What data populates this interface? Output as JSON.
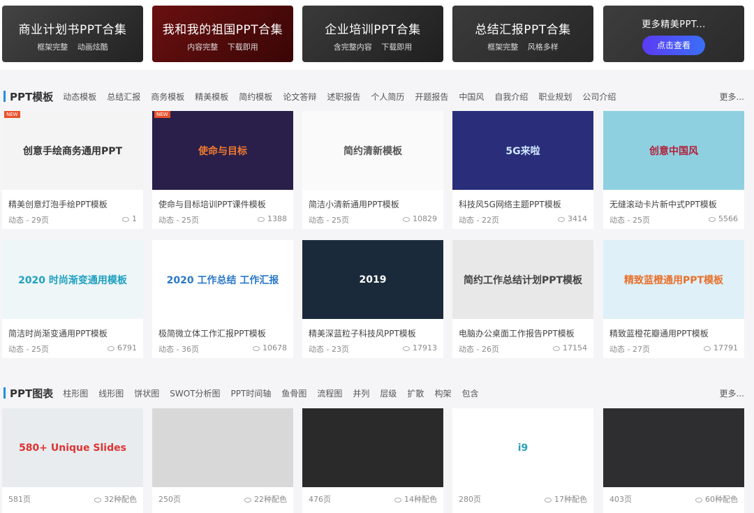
{
  "banners": [
    {
      "title": "商业计划书PPT合集",
      "sub": "框架完整 动画炫酷",
      "bg": "linear-gradient(135deg,#444,#222)"
    },
    {
      "title": "我和我的祖国PPT合集",
      "sub": "内容完整 下载即用",
      "bg": "linear-gradient(135deg,#6a1010,#3a0606)"
    },
    {
      "title": "企业培训PPT合集",
      "sub": "含完整内容 下载即用",
      "bg": "linear-gradient(135deg,#3a3a3a,#1f1f1f)"
    },
    {
      "title": "总结汇报PPT合集",
      "sub": "框架完整 风格多样",
      "bg": "linear-gradient(135deg,#3b3b3b,#262626)"
    },
    {
      "title": "更多精美PPT...",
      "button": "点击查看",
      "bg": "linear-gradient(135deg,#3d3d3d,#2a2a2a)"
    }
  ],
  "templates": {
    "title": "PPT模板",
    "categories": [
      "动态模板",
      "总结汇报",
      "商务模板",
      "精美模板",
      "简约模板",
      "论文答辩",
      "述职报告",
      "个人简历",
      "开题报告",
      "中国风",
      "自我介绍",
      "职业规划",
      "公司介绍"
    ],
    "more": "更多...",
    "new_badge": "NEW",
    "cards": [
      {
        "thumb": "创意手绘商务通用PPT",
        "bg": "#f4f4f4",
        "fg": "#333",
        "new": true,
        "name": "精美创意灯泡手绘PPT模板",
        "meta": "动态 - 29页",
        "views": "1"
      },
      {
        "thumb": "使命与目标",
        "bg": "#2a1f4a",
        "fg": "#f07a30",
        "new": true,
        "name": "使命与目标培训PPT课件模板",
        "meta": "动态 - 25页",
        "views": "1388"
      },
      {
        "thumb": "简约清新模板",
        "bg": "#fafafa",
        "fg": "#555",
        "name": "简洁小清新通用PPT模板",
        "meta": "动态 - 25页",
        "views": "10829"
      },
      {
        "thumb": "5G来啦",
        "bg": "#2a2d7a",
        "fg": "#cfe8ff",
        "name": "科技风5G网络主题PPT模板",
        "meta": "动态 - 22页",
        "views": "3414"
      },
      {
        "thumb": "创意中国风",
        "bg": "#8fd0e0",
        "fg": "#b0203a",
        "name": "无缝滚动卡片新中式PPT模板",
        "meta": "动态 - 25页",
        "views": "5566"
      },
      {
        "thumb": "2020 时尚渐变通用模板",
        "bg": "#eef6f8",
        "fg": "#1fa0c0",
        "name": "简洁时尚渐变通用PPT模板",
        "meta": "动态 - 25页",
        "views": "6791"
      },
      {
        "thumb": "2020 工作总结 工作汇报",
        "bg": "#ffffff",
        "fg": "#2a78c8",
        "name": "极简微立体工作汇报PPT模板",
        "meta": "动态 - 36页",
        "views": "10678"
      },
      {
        "thumb": "2019",
        "bg": "#1a2a3a",
        "fg": "#fff",
        "name": "精美深蓝粒子科技风PPT模板",
        "meta": "动态 - 23页",
        "views": "17913"
      },
      {
        "thumb": "简约工作总结计划PPT模板",
        "bg": "#e8e8e8",
        "fg": "#444",
        "name": "电脑办公桌面工作报告PPT模板",
        "meta": "动态 - 26页",
        "views": "17154"
      },
      {
        "thumb": "精致蓝橙通用PPT模板",
        "bg": "#dff0f8",
        "fg": "#e8712c",
        "name": "精致蓝橙花瓣通用PPT模板",
        "meta": "动态 - 27页",
        "views": "17791"
      }
    ]
  },
  "charts": {
    "title": "PPT图表",
    "categories": [
      "柱形图",
      "线形图",
      "饼状图",
      "SWOT分析图",
      "PPT时间轴",
      "鱼骨图",
      "流程图",
      "并列",
      "层级",
      "扩散",
      "构架",
      "包含"
    ],
    "more": "更多...",
    "cards": [
      {
        "thumb": "580+ Unique Slides",
        "bg": "#e8ecee",
        "fg": "#d33",
        "pages": "581页",
        "colors": "32种配色"
      },
      {
        "thumb": "",
        "bg": "#d8d8d8",
        "fg": "#333",
        "pages": "250页",
        "colors": "22种配色"
      },
      {
        "thumb": "",
        "bg": "#2a2a2a",
        "fg": "#fff",
        "pages": "476页",
        "colors": "14种配色"
      },
      {
        "thumb": "i9",
        "bg": "#ffffff",
        "fg": "#2aa0b8",
        "pages": "280页",
        "colors": "17种配色"
      },
      {
        "thumb": "",
        "bg": "#2e2e30",
        "fg": "#fff",
        "pages": "403页",
        "colors": "60种配色"
      }
    ]
  }
}
